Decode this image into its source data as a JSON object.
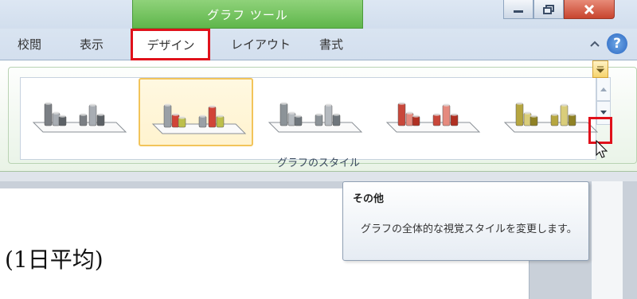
{
  "title_bar": {
    "context_group_label": "グラフ ツール",
    "window_buttons": [
      "minimize-icon",
      "restore-icon",
      "close-icon"
    ]
  },
  "tabs": [
    {
      "label": "校閲",
      "active": false
    },
    {
      "label": "表示",
      "active": false
    },
    {
      "label": "デザイン",
      "active": true,
      "highlighted": true
    },
    {
      "label": "レイアウト",
      "active": false
    },
    {
      "label": "書式",
      "active": false
    }
  ],
  "ribbon_icons": [
    "collapse-ribbon-icon",
    "help-icon"
  ],
  "gallery": {
    "group_label": "グラフのスタイル",
    "styles": [
      {
        "colors": [
          "#7b7f84",
          "#a8adb3",
          "#5c6166"
        ],
        "selected": false
      },
      {
        "colors": [
          "#9aa0a6",
          "#d14437",
          "#bdbf4a"
        ],
        "selected": true
      },
      {
        "colors": [
          "#8c9398",
          "#b5babf",
          "#6f767c"
        ],
        "selected": false
      },
      {
        "colors": [
          "#c8473a",
          "#e58a7e",
          "#b03022"
        ],
        "selected": false
      },
      {
        "colors": [
          "#b6a640",
          "#d9cd7a",
          "#8f8124"
        ],
        "selected": false
      }
    ],
    "more_button_highlighted": true
  },
  "tooltip": {
    "title": "その他",
    "body": "グラフの全体的な視覚スタイルを変更します。"
  },
  "document": {
    "visible_text": "(1日平均)"
  },
  "colors": {
    "context_green": "#5fb64b",
    "highlight_red": "#e0111b",
    "selected_gold": "#f2c45a"
  }
}
